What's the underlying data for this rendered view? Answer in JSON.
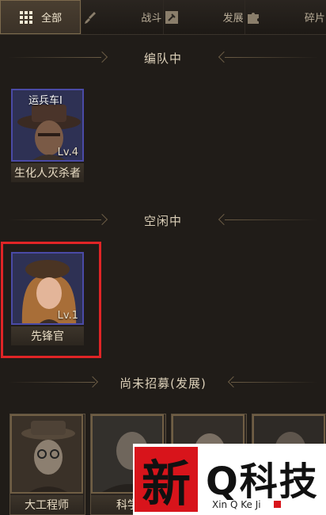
{
  "tabs": [
    {
      "label": "全部",
      "icon": "grid-icon",
      "active": true
    },
    {
      "label": "战斗",
      "icon": "sword-icon",
      "active": false
    },
    {
      "label": "发展",
      "icon": "hammer-icon",
      "active": false
    },
    {
      "label": "碎片",
      "icon": "puzzle-icon",
      "active": false
    }
  ],
  "sections": {
    "formation": {
      "title": "编队中"
    },
    "idle": {
      "title": "空闲中"
    },
    "unrecruited": {
      "title": "尚未招募(发展)"
    }
  },
  "formation_heroes": [
    {
      "name": "生化人灭杀者",
      "level": "Lv.4",
      "tag": "运兵车I"
    }
  ],
  "idle_heroes": [
    {
      "name": "先锋官",
      "level": "Lv.1"
    }
  ],
  "unrecruited_heroes": [
    {
      "name": "大工程师"
    },
    {
      "name": "科学"
    },
    {
      "name": ""
    },
    {
      "name": ""
    }
  ],
  "watermark": {
    "logo_char": "新",
    "main_text": "Q科技",
    "sub_text": "Xin Q Ke Ji"
  },
  "colors": {
    "background": "#201c18",
    "highlight_border": "#e02426",
    "portrait_border": "#4a4aa6"
  }
}
